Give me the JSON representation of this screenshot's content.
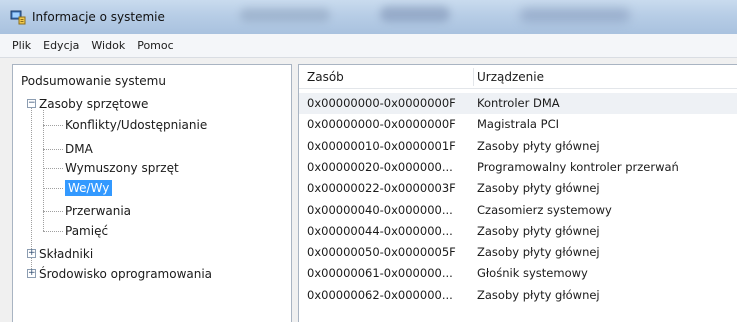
{
  "window": {
    "title": "Informacje o systemie",
    "icon": "system-info-icon"
  },
  "menu": [
    "Plik",
    "Edycja",
    "Widok",
    "Pomoc"
  ],
  "tree": {
    "root": "Podsumowanie systemu",
    "hardware": "Zasoby sprzętowe",
    "hardware_children": [
      "Konflikty/Udostępnianie",
      "DMA",
      "Wymuszony sprzęt",
      "We/Wy",
      "Przerwania",
      "Pamięć"
    ],
    "selected": "We/Wy",
    "components": "Składniki",
    "software": "Środowisko oprogramowania"
  },
  "table": {
    "columns": [
      "Zasób",
      "Urządzenie"
    ],
    "rows": [
      [
        "0x00000000-0x0000000F",
        "Kontroler DMA"
      ],
      [
        "0x00000000-0x0000000F",
        "Magistrala PCI"
      ],
      [
        "0x00000010-0x0000001F",
        "Zasoby płyty głównej"
      ],
      [
        "0x00000020-0x000000...",
        "Programowalny kontroler przerwań"
      ],
      [
        "0x00000022-0x0000003F",
        "Zasoby płyty głównej"
      ],
      [
        "0x00000040-0x000000...",
        "Czasomierz systemowy"
      ],
      [
        "0x00000044-0x000000...",
        "Zasoby płyty głównej"
      ],
      [
        "0x00000050-0x0000005F",
        "Zasoby płyty głównej"
      ],
      [
        "0x00000061-0x000000...",
        "Głośnik systemowy"
      ],
      [
        "0x00000062-0x000000...",
        "Zasoby płyty głównej"
      ]
    ]
  }
}
